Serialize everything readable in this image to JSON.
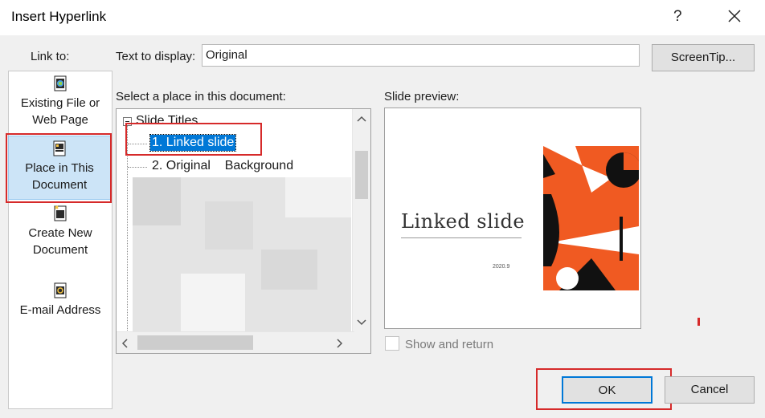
{
  "window": {
    "title": "Insert Hyperlink",
    "help": "?"
  },
  "linkto": {
    "label": "Link to:",
    "items": [
      {
        "label": "Existing File or Web Page",
        "selected": false,
        "icon": "globe-file-icon"
      },
      {
        "label": "Place in This Document",
        "selected": true,
        "icon": "document-place-icon"
      },
      {
        "label": "Create New Document",
        "selected": false,
        "icon": "new-document-icon"
      },
      {
        "label": "E-mail Address",
        "selected": false,
        "icon": "email-icon"
      }
    ]
  },
  "display": {
    "label": "Text to display:",
    "value": "Original",
    "screentip_label": "ScreenTip..."
  },
  "place": {
    "label": "Select a place in this document:",
    "root": "Slide Titles",
    "items": [
      {
        "label": "1. Linked slide",
        "selected": true
      },
      {
        "label": "2. Original    Background",
        "selected": false
      }
    ]
  },
  "preview": {
    "label": "Slide preview:",
    "slide_title": "Linked slide",
    "slide_date": "2020.9",
    "show_and_return": {
      "label": "Show and return",
      "checked": false,
      "enabled": false
    }
  },
  "buttons": {
    "ok": "OK",
    "cancel": "Cancel"
  },
  "colors": {
    "accent": "#0078d7",
    "selection": "#cce4f7",
    "highlight_box": "#d62a2a",
    "slide_orange": "#f05a22"
  }
}
